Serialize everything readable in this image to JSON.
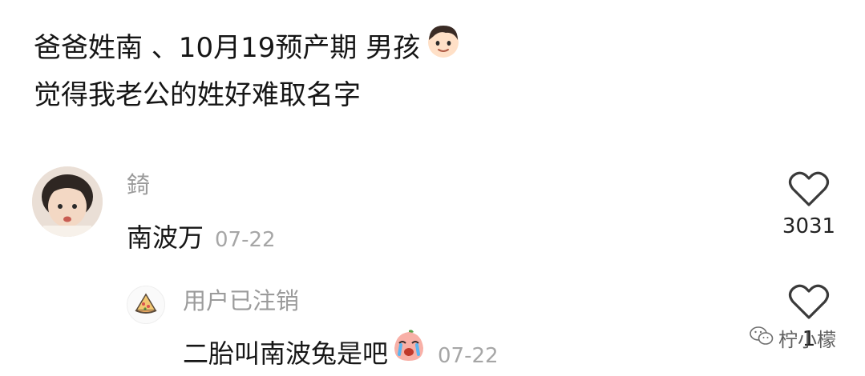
{
  "post": {
    "line1": "爸爸姓南 、10月19预产期 男孩",
    "line1_emoji": "boy-face-emoji",
    "line2": "觉得我老公的姓好难取名字"
  },
  "comments": [
    {
      "username": "錡",
      "text": "南波万",
      "date": "07-22",
      "likes": "3031"
    },
    {
      "username": "用户已注销",
      "text": "二胎叫南波兔是吧",
      "text_emoji": "crying-peach-emoji",
      "date": "07-22",
      "likes": "1"
    }
  ],
  "watermark": {
    "text": "柠小檬",
    "icon": "wechat-icon"
  },
  "colors": {
    "text": "#161616",
    "muted": "#9b9b9b"
  }
}
